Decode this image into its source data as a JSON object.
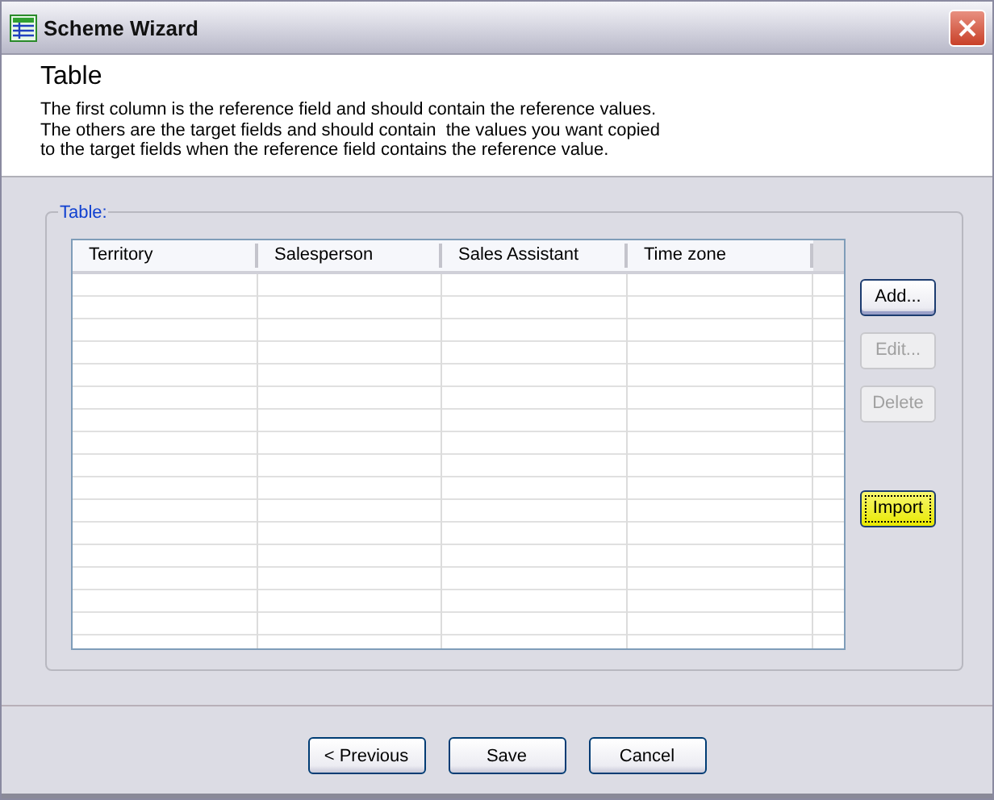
{
  "window": {
    "title": "Scheme Wizard"
  },
  "header": {
    "title": "Table",
    "description": [
      "The first column is the reference field and should contain the reference values.",
      "The others are the target fields and should contain  the values you want copied",
      "to the target fields when the reference field contains the reference value."
    ]
  },
  "group": {
    "label": "Table:"
  },
  "table": {
    "columns": [
      "Territory",
      "Salesperson",
      "Sales Assistant",
      "Time zone"
    ]
  },
  "side_buttons": [
    {
      "label": "Add...",
      "disabled": false,
      "highlighted": false,
      "default": true
    },
    {
      "label": "Edit...",
      "disabled": true,
      "highlighted": false,
      "default": false
    },
    {
      "label": "Delete",
      "disabled": true,
      "highlighted": false,
      "default": false
    },
    {
      "label": "Import",
      "disabled": false,
      "highlighted": true,
      "default": false
    }
  ],
  "footer_buttons": [
    {
      "label": "< Previous"
    },
    {
      "label": "Save"
    },
    {
      "label": "Cancel"
    }
  ]
}
